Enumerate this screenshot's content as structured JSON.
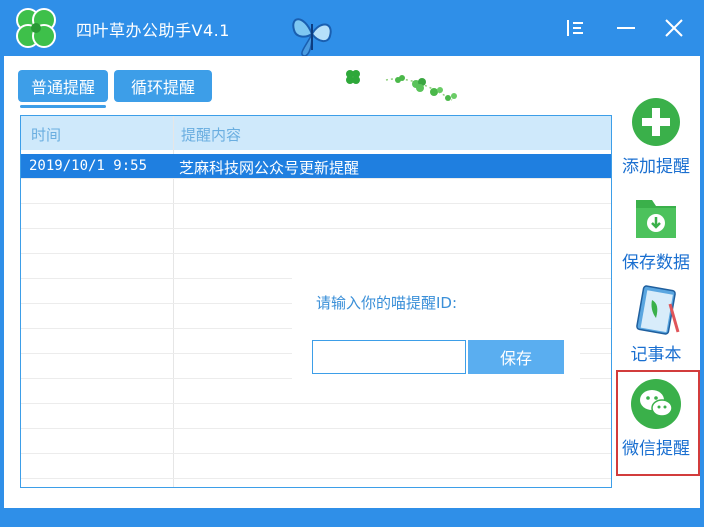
{
  "window": {
    "title": "四叶草办公助手V4.1",
    "logo_icon": "four-leaf-clover-icon",
    "decoration_icon": "butterfly-icon",
    "menu_icon": "menu-icon",
    "minimize_icon": "minimize-icon",
    "close_icon": "close-icon"
  },
  "tabs": [
    {
      "label": "普通提醒",
      "active": true
    },
    {
      "label": "循环提醒",
      "active": false
    }
  ],
  "list": {
    "columns": [
      "时间",
      "提醒内容"
    ],
    "rows": [
      {
        "time": "2019/10/1 9:55",
        "content": "芝麻科技网公众号更新提醒",
        "selected": true
      }
    ]
  },
  "wechat_prompt": {
    "label": "请输入你的喵提醒ID:",
    "input_value": "",
    "input_placeholder": "",
    "save_label": "保存"
  },
  "sidebar": {
    "items": [
      {
        "label": "添加提醒",
        "icon": "add-icon"
      },
      {
        "label": "保存数据",
        "icon": "folder-download-icon"
      },
      {
        "label": "记事本",
        "icon": "notebook-icon"
      },
      {
        "label": "微信提醒",
        "icon": "wechat-icon",
        "highlighted": true
      }
    ]
  },
  "colors": {
    "title_bar": "#2f8fe8",
    "accent": "#3d9ee8",
    "selected_row": "#1f7fe0",
    "header_bg": "#cfe9fb",
    "highlight_frame": "#d23c3c",
    "icon_green": "#3ab04a"
  }
}
